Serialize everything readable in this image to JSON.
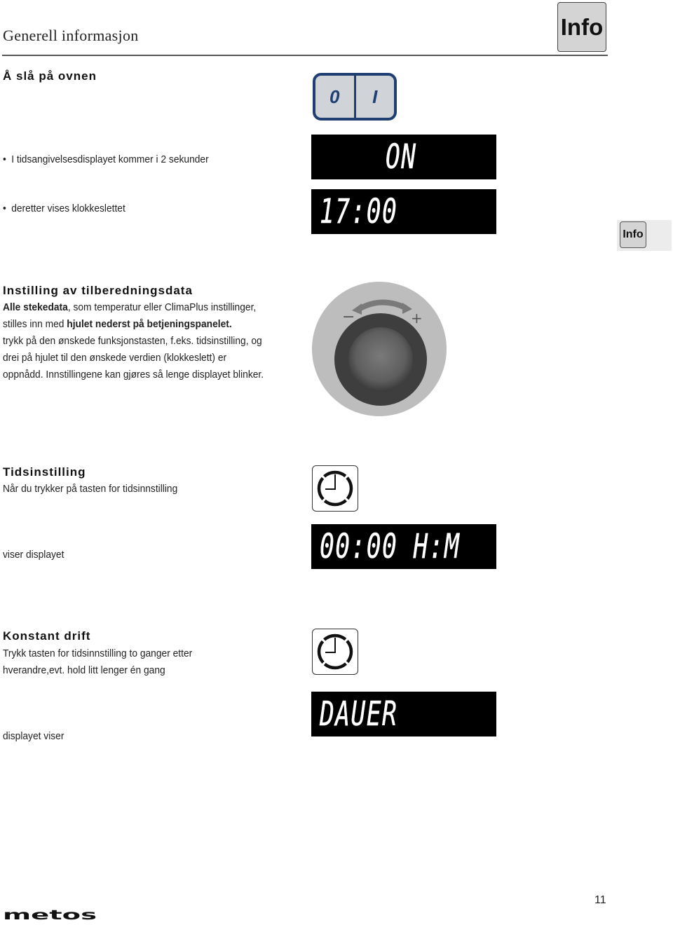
{
  "header": {
    "title": "Generell informasjon",
    "tab_label": "Info"
  },
  "side_tab": {
    "label": "Info"
  },
  "section_on": {
    "heading": "Å slå på ovnen",
    "bullets": [
      "I tidsangivelsesdisplayet kommer i 2 sekunder",
      "deretter vises klokkeslettet"
    ],
    "switch": {
      "off_label": "0",
      "on_label": "I"
    },
    "display_on": "ON",
    "display_clock": "17:00"
  },
  "section_settings": {
    "heading": "Instilling av tilberedningsdata",
    "line1_bold": "Alle stekedata",
    "line1_rest": ", som temperatur eller ClimaPlus instillinger,",
    "line2_plain": "stilles inn med ",
    "line2_bold": "hjulet nederst på betjeningspanelet.",
    "line3": "trykk på den ønskede funksjonstasten, f.eks. tidsinstilling, og",
    "line4": "drei på hjulet til den ønskede verdien (klokkeslett) er",
    "line5": "oppnådd. Innstillingene kan gjøres så lenge displayet blinker.",
    "dial": {
      "minus": "−",
      "plus": "+"
    }
  },
  "section_timer": {
    "heading": "Tidsinstilling",
    "text": "Når du trykker på tasten for tidsinnstilling",
    "caption": "viser displayet",
    "display": "00:00 H:M",
    "key_icon": "clock-icon"
  },
  "section_constant": {
    "heading": "Konstant drift",
    "text_line1": "Trykk tasten for tidsinnstilling to ganger etter",
    "text_line2": "hverandre,evt. hold litt lenger én gang",
    "caption": "displayet viser",
    "display": "DAUER",
    "key_icon": "clock-icon"
  },
  "footer": {
    "page_number": "11",
    "logo_text": "metos"
  },
  "colors": {
    "switch_blue": "#1f3f73",
    "key_gray": "#d4d4d4",
    "lcd_background": "#000000"
  }
}
